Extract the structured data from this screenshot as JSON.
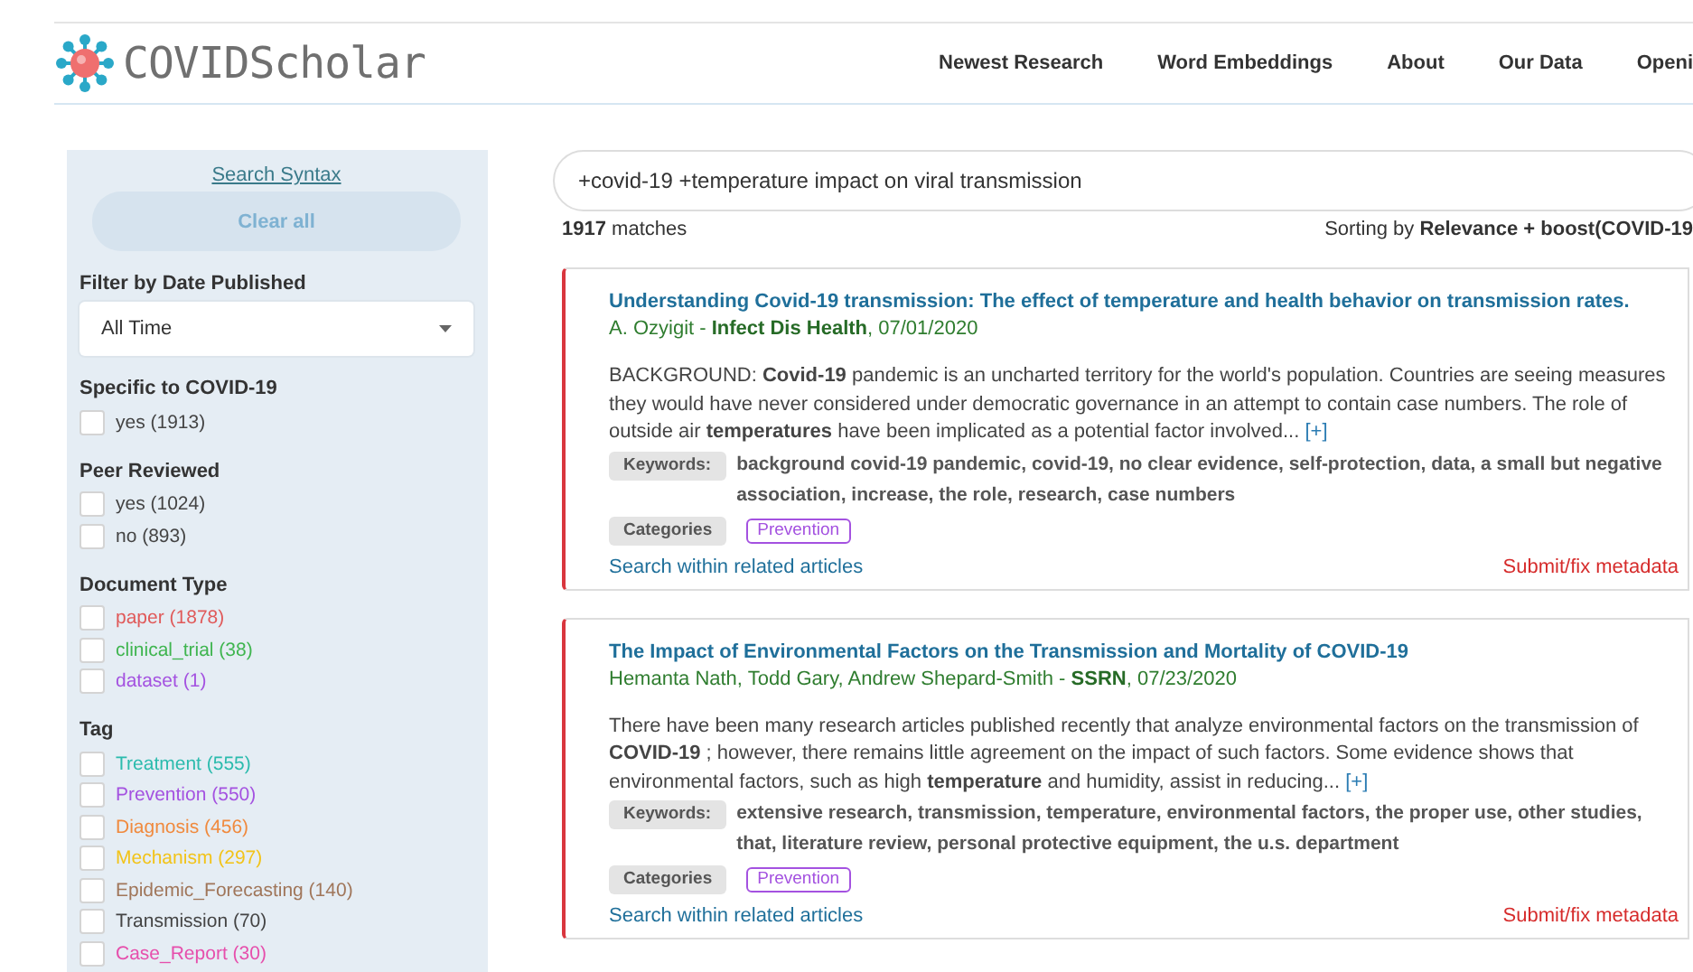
{
  "header": {
    "logo": "COVIDScholar",
    "nav": [
      {
        "label": "Newest Research"
      },
      {
        "label": "Word Embeddings"
      },
      {
        "label": "About"
      },
      {
        "label": "Our Data"
      },
      {
        "label": "Openi"
      }
    ]
  },
  "sidebar": {
    "syntax_link": "Search Syntax",
    "clear_button": {
      "label": "Clear all",
      "disabled": true
    },
    "date_filter": {
      "title": "Filter by Date Published",
      "value": "All Time"
    },
    "groups": [
      {
        "title": "Specific to COVID-19",
        "options": [
          {
            "label": "yes (1913)",
            "checked": false
          }
        ]
      },
      {
        "title": "Peer Reviewed",
        "options": [
          {
            "label": "yes (1024)",
            "checked": false
          },
          {
            "label": "no (893)",
            "checked": false
          }
        ]
      },
      {
        "title": "Document Type",
        "options": [
          {
            "label": "paper (1878)",
            "checked": false,
            "color": "#e05a5a"
          },
          {
            "label": "clinical_trial (38)",
            "checked": false,
            "color": "#3fb54f"
          },
          {
            "label": "dataset (1)",
            "checked": false,
            "color": "#a452e0"
          }
        ]
      },
      {
        "title": "Tag",
        "options": [
          {
            "label": "Treatment (555)",
            "checked": false,
            "color": "#2bbbad"
          },
          {
            "label": "Prevention (550)",
            "checked": false,
            "color": "#a452e0"
          },
          {
            "label": "Diagnosis (456)",
            "checked": false,
            "color": "#f08a3e"
          },
          {
            "label": "Mechanism (297)",
            "checked": false,
            "color": "#f2c318"
          },
          {
            "label": "Epidemic_Forecasting (140)",
            "checked": false,
            "color": "#a0765a"
          },
          {
            "label": "Transmission (70)",
            "checked": false,
            "color": "#444444"
          },
          {
            "label": "Case_Report (30)",
            "checked": false,
            "color": "#e64fac"
          }
        ]
      }
    ]
  },
  "search": {
    "value": "+covid-19 +temperature impact on viral transmission"
  },
  "results_bar": {
    "count": "1917",
    "count_label": "matches",
    "sort_label": "Sorting by",
    "sort_value": "Relevance + boost(COVID-19"
  },
  "results": [
    {
      "title": "Understanding Covid-19 transmission: The effect of temperature and health behavior on transmission rates.",
      "byline": "A. Ozyigit - **Infect Dis Health**, 07/01/2020",
      "abstract": "BACKGROUND: **Covid-19** pandemic is an uncharted territory for the world's population. Countries are seeing measures they would have never considered under democratic governance in an attempt to contain case numbers. The role of outside air **temperatures** have been implicated as a potential factor involved...",
      "more": "[+]",
      "keywords_label": "Keywords:",
      "keywords": "background covid-19 pandemic, covid-19, no clear evidence, self-protection, data, a small but negative association, increase, the role, research, case numbers",
      "categories_label": "Categories",
      "categories": [
        "Prevention"
      ],
      "related_link": "Search within related articles",
      "fix_link": "Submit/fix metadata"
    },
    {
      "title": "The Impact of Environmental Factors on the Transmission and Mortality of COVID-19",
      "byline": "Hemanta Nath, Todd Gary, Andrew Shepard-Smith - **SSRN**, 07/23/2020",
      "abstract": "There have been many research articles published recently that analyze environmental factors on the transmission of **COVID-19** ; however, there remains little agreement on the impact of such factors. Some evidence shows that environmental factors, such as high **temperature** and humidity, assist in reducing...",
      "more": "[+]",
      "keywords_label": "Keywords:",
      "keywords": "extensive research, transmission, temperature, environmental factors, the proper use, other studies, that, literature review, personal protective equipment, the u.s. department",
      "categories_label": "Categories",
      "categories": [
        "Prevention"
      ],
      "related_link": "Search within related articles",
      "fix_link": "Submit/fix metadata"
    }
  ]
}
